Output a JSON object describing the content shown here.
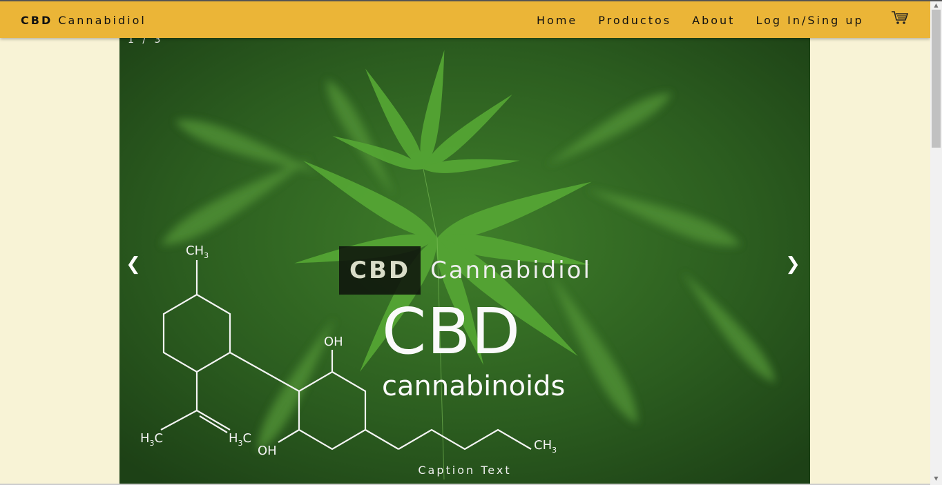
{
  "navbar": {
    "brand_bold": "CBD",
    "brand_rest": "Cannabidiol",
    "links": [
      "Home",
      "Productos",
      "About",
      "Log In/Sing up"
    ]
  },
  "slideshow": {
    "counter": "1 / 3",
    "prev_label": "❮",
    "next_label": "❯",
    "title_bold": "CBD",
    "title_rest": "Cannabidiol",
    "image_text_main": "CBD",
    "image_text_sub": "cannabinoids",
    "molecule_labels": [
      "CH3",
      "OH",
      "H3C",
      "H3C",
      "OH",
      "CH3"
    ],
    "caption": "Caption Text"
  },
  "colors": {
    "navbar": "#ebb537",
    "page_bg": "#f8f3d6",
    "leaf_green": "#4a9a2c"
  },
  "icons": [
    "cart-icon"
  ]
}
